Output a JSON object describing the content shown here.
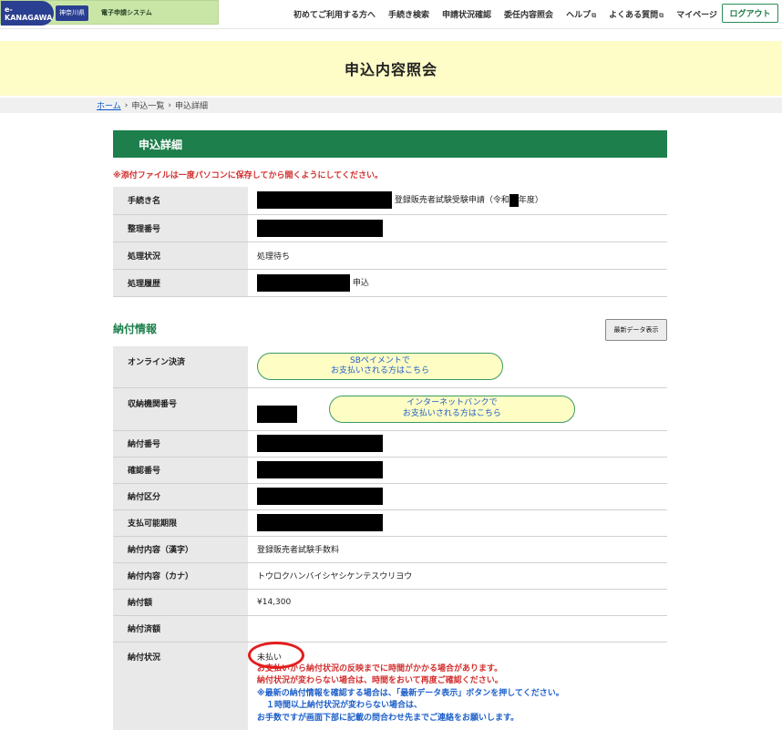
{
  "header": {
    "logo_brand": "e-KANAGAWA",
    "logo_pref": "神奈川県",
    "logo_sys": "電子申請システム",
    "nav": [
      {
        "label": "初めてご利用する方へ",
        "external": false
      },
      {
        "label": "手続き検索",
        "external": false
      },
      {
        "label": "申請状況確認",
        "external": false
      },
      {
        "label": "委任内容照会",
        "external": false
      },
      {
        "label": "ヘルプ",
        "external": true
      },
      {
        "label": "よくある質問",
        "external": true
      },
      {
        "label": "マイページ",
        "external": false
      }
    ],
    "logout": "ログアウト"
  },
  "page_title": "申込内容照会",
  "breadcrumb": {
    "home": "ホーム",
    "sep1": "›",
    "list": "申込一覧",
    "sep2": "›",
    "current": "申込詳細"
  },
  "detail": {
    "title": "申込詳細",
    "warning": "※添付ファイルは一度パソコンに保存してから開くようにしてください。",
    "rows": [
      {
        "label": "手続き名",
        "value": "登録販売者試験受験申請（令和",
        "suffix": "年度）"
      },
      {
        "label": "整理番号",
        "value": ""
      },
      {
        "label": "処理状況",
        "value": "処理待ち"
      },
      {
        "label": "処理履歴",
        "value": "申込"
      }
    ]
  },
  "payment": {
    "title": "納付情報",
    "refresh": "最新データ表示",
    "online_label": "オンライン決済",
    "sb_btn_line1": "SBペイメントで",
    "sb_btn_line2": "お支払いされる方はこちら",
    "org_label": "収納機関番号",
    "bank_btn_line1": "インターネットバンクで",
    "bank_btn_line2": "お支払いされる方はこちら",
    "rows": [
      {
        "label": "納付番号"
      },
      {
        "label": "確認番号"
      },
      {
        "label": "納付区分"
      },
      {
        "label": "支払可能期限"
      }
    ],
    "content_kanji_label": "納付内容（漢字）",
    "content_kanji": "登録販売者試験手数料",
    "content_kana_label": "納付内容（カナ）",
    "content_kana": "トウロクハンバイシヤシケンテスウリヨウ",
    "amount_label": "納付額",
    "amount": "¥14,300",
    "paid_label": "納付済額",
    "paid": "",
    "status_label": "納付状況",
    "status": "未払い",
    "notes_red": [
      "お支払いから納付状況の反映までに時間がかかる場合があります。",
      "納付状況が変わらない場合は、時間をおいて再度ご確認ください。"
    ],
    "notes_blue": [
      "※最新の納付情報を確認する場合は、「最新データ表示」ボタンを押してください。",
      "１時間以上納付状況が変わらない場合は、",
      "お手数ですが画面下部に記載の問合わせ先までご連絡をお願いします。"
    ]
  },
  "colors": {
    "green": "#1d7f4b",
    "banner": "#fefcc7",
    "warning_red": "#d32f2f",
    "note_blue": "#1d5fc9",
    "highlight_circle": "#e31d1d"
  }
}
